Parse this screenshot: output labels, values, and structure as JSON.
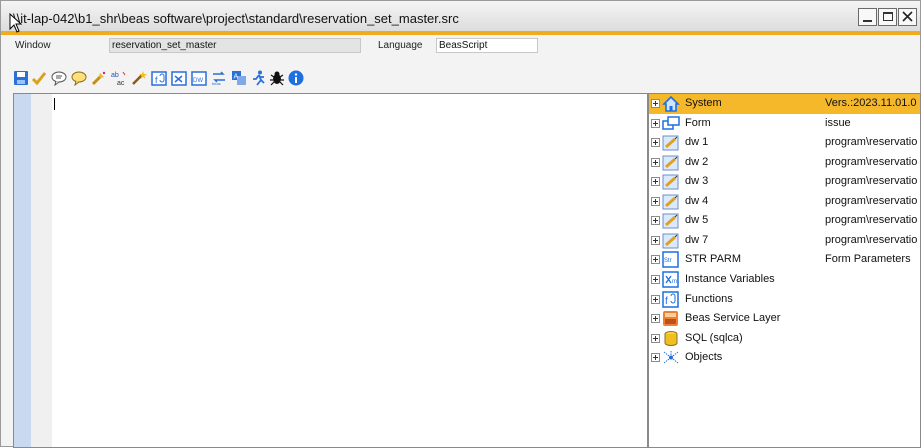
{
  "window": {
    "title": "\\\\it-lap-042\\b1_shr\\beas software\\project\\standard\\reservation_set_master.src",
    "controls": [
      "minimize-icon",
      "maximize-icon",
      "close-icon"
    ]
  },
  "info": {
    "window_label": "Window",
    "window_value": "reservation_set_master",
    "language_label": "Language",
    "language_value": "BeasScript"
  },
  "toolbar": {
    "icons": [
      "save-icon",
      "check-icon",
      "comment-icon",
      "uncomment-icon",
      "replace-icon",
      "abc-replace-icon",
      "wand-icon",
      "function-icon",
      "xml-icon",
      "dw-icon",
      "beas-icon",
      "translate-icon",
      "run-icon",
      "debug-icon",
      "info-icon"
    ]
  },
  "colors": {
    "accent": "#f0ac1c",
    "selection": "#f5b82a",
    "gutter": "#c9d9ef"
  },
  "tree": {
    "items": [
      {
        "name": "System",
        "value": "Vers.:2023.11.01.0",
        "icon": "house-icon",
        "selected": true
      },
      {
        "name": "Form",
        "value": "issue",
        "icon": "form-icon"
      },
      {
        "name": "dw  1",
        "value": "program\\reservatio",
        "icon": "datawindow-icon"
      },
      {
        "name": "dw  2",
        "value": "program\\reservatio",
        "icon": "datawindow-icon"
      },
      {
        "name": "dw  3",
        "value": "program\\reservatio",
        "icon": "datawindow-icon"
      },
      {
        "name": "dw  4",
        "value": "program\\reservatio",
        "icon": "datawindow-icon"
      },
      {
        "name": "dw  5",
        "value": "program\\reservatio",
        "icon": "datawindow-icon"
      },
      {
        "name": "dw  7",
        "value": "program\\reservatio",
        "icon": "datawindow-icon"
      },
      {
        "name": "STR  PARM",
        "value": "Form Parameters",
        "icon": "str-icon"
      },
      {
        "name": "Instance Variables",
        "value": "",
        "icon": "variables-icon"
      },
      {
        "name": "Functions",
        "value": "",
        "icon": "functions-icon"
      },
      {
        "name": "Beas Service Layer",
        "value": "",
        "icon": "service-layer-icon"
      },
      {
        "name": "SQL (sqlca)",
        "value": "",
        "icon": "database-icon"
      },
      {
        "name": "Objects",
        "value": "",
        "icon": "objects-icon"
      }
    ]
  }
}
